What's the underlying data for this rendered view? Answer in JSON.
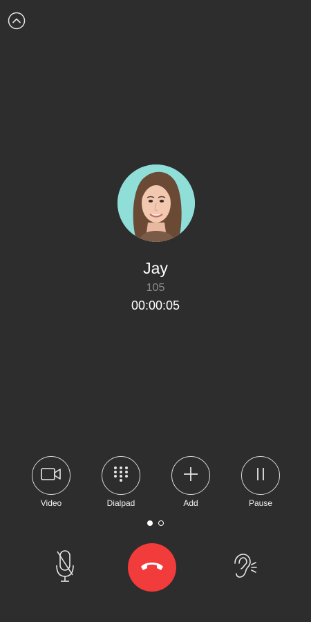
{
  "header": {
    "collapse_icon": "chevron-up-circle-icon"
  },
  "caller": {
    "name": "Jay",
    "extension": "105",
    "duration": "00:00:05",
    "avatar_bg": "#8fded8"
  },
  "actions": [
    {
      "label": "Video",
      "icon": "video-camera-icon"
    },
    {
      "label": "Dialpad",
      "icon": "dialpad-icon"
    },
    {
      "label": "Add",
      "icon": "plus-icon"
    },
    {
      "label": "Pause",
      "icon": "pause-icon"
    }
  ],
  "pager": {
    "page_count": 2,
    "active_page": 1
  },
  "controls": {
    "mute_icon": "microphone-off-icon",
    "hangup_icon": "phone-hangup-icon",
    "earpiece_icon": "ear-icon",
    "hangup_color": "#f23b3b"
  },
  "colors": {
    "background": "#2d2d2d",
    "text_primary": "#ffffff",
    "text_secondary": "#8c8c8c"
  }
}
